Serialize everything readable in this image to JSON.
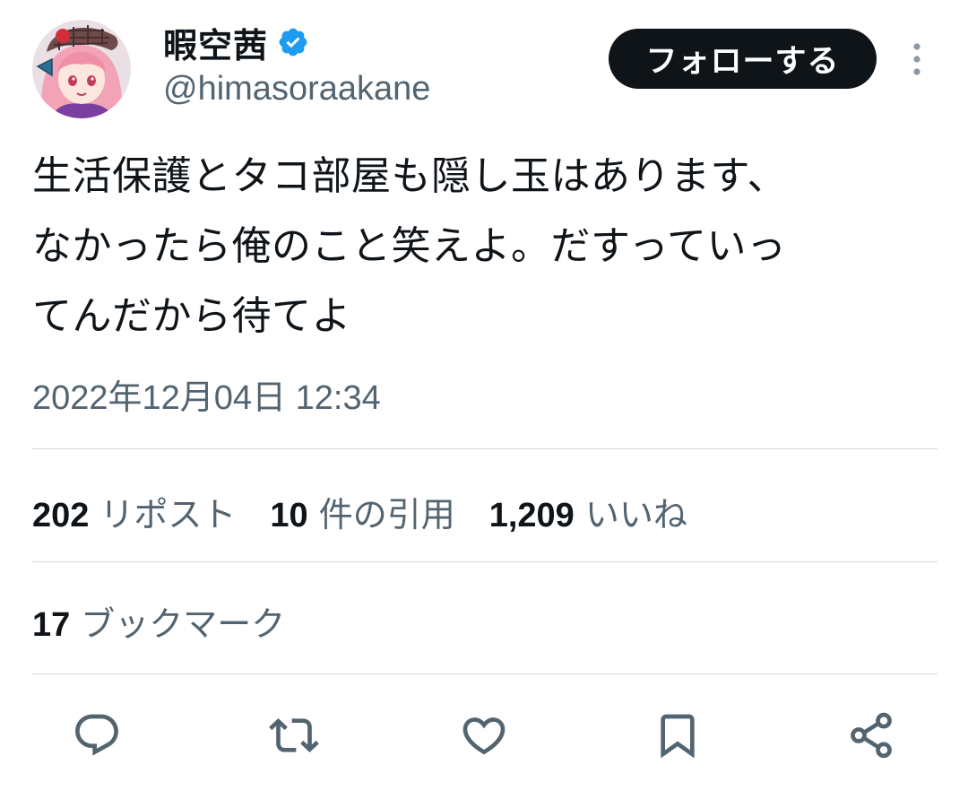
{
  "author": {
    "display_name": "暇空茜",
    "handle": "@himasoraakane",
    "avatar_icon": "avatar-image",
    "verified": true,
    "verified_color": "#1d9bf0"
  },
  "header": {
    "follow_label": "フォローする",
    "more_icon": "more-vertical-icon"
  },
  "tweet": {
    "text_lines": [
      "生活保護とタコ部屋も隠し玉はあります、",
      "なかったら俺のこと笑えよ。だすっていっ",
      "てんだから待てよ"
    ],
    "timestamp": "2022年12月04日 12:34"
  },
  "stats": {
    "reposts": {
      "count": "202",
      "label": "リポスト"
    },
    "quotes": {
      "count": "10",
      "label": "件の引用"
    },
    "likes": {
      "count": "1,209",
      "label": "いいね"
    },
    "bookmarks": {
      "count": "17",
      "label": "ブックマーク"
    }
  },
  "actions": [
    {
      "name": "reply-icon"
    },
    {
      "name": "repost-icon"
    },
    {
      "name": "like-icon"
    },
    {
      "name": "bookmark-icon"
    },
    {
      "name": "share-icon"
    }
  ],
  "colors": {
    "text_primary": "#0f1419",
    "text_secondary": "#536471",
    "divider": "#cfd9de",
    "button_bg": "#0f1419"
  }
}
